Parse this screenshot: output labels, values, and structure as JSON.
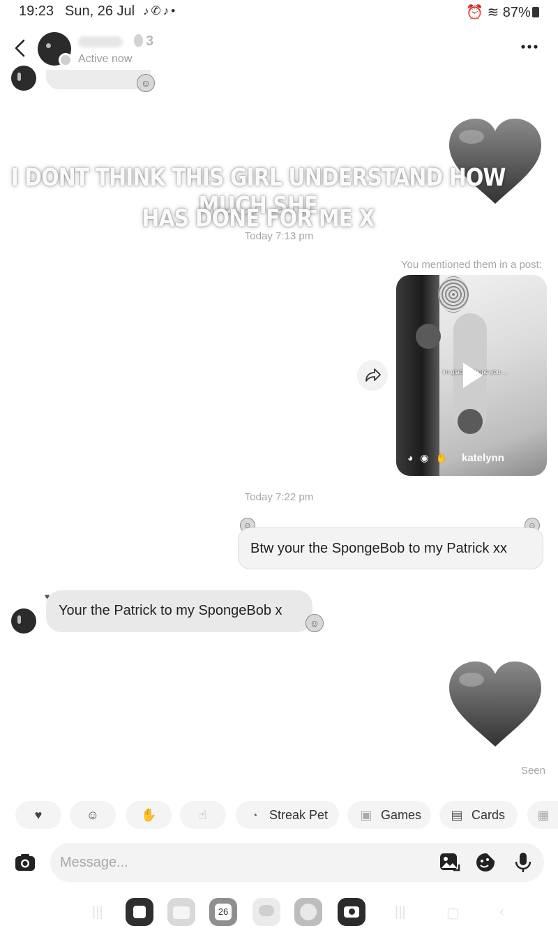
{
  "status_bar": {
    "time": "19:23",
    "date": "Sun, 26 Jul",
    "notification_icons": [
      "tiktok-icon",
      "whatsapp-icon",
      "tiktok-icon",
      "dot"
    ],
    "battery": "87%"
  },
  "header": {
    "status": "Active now",
    "streak_count": "3"
  },
  "conversation": {
    "caption_line1": "I DONT THINK THIS GIRL UNDERSTAND HOW MUCH SHE",
    "caption_line2": "HAS DONE FOR ME X",
    "timestamp1": "Today 7:13 pm",
    "mention_label": "You mentioned them in a post:",
    "post_username": "katelynn",
    "post_overlay": "im glad i ... hope you ...",
    "timestamp2": "Today 7:22 pm",
    "outgoing_message": "Btw your the SpongeBob to my Patrick xx",
    "incoming_message": "Your the Patrick to my SpongeBob x",
    "seen_label": "Seen"
  },
  "quick_actions": {
    "streak_pet": "Streak Pet",
    "games": "Games",
    "cards": "Cards"
  },
  "composer": {
    "placeholder": "Message..."
  },
  "dock": {
    "calendar_day": "26"
  }
}
